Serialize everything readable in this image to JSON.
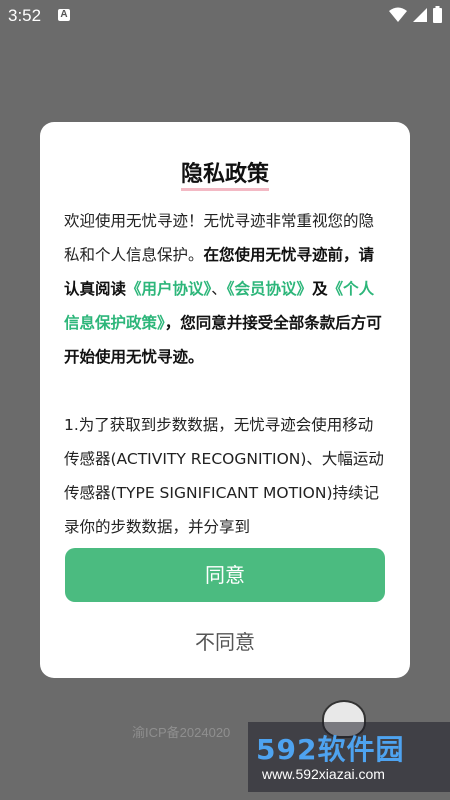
{
  "status_bar": {
    "time": "3:52",
    "notification_icon": "A",
    "icons": [
      "wifi-icon",
      "signal-icon",
      "battery-icon"
    ]
  },
  "background": {
    "footer_text": "渝ICP备2024020",
    "watermark_brand": "592软件园",
    "watermark_url": "www.592xiazai.com"
  },
  "dialog": {
    "title": "隐私政策",
    "p1_intro": "欢迎使用无忧寻迹！无忧寻迹非常重视您的隐私和个人信息保护。",
    "p1_bold_a": "在您使用无忧寻迹前，请认真阅读",
    "link_user": "《用户协议》",
    "sep1": "、",
    "link_member": "《会员协议》",
    "sep2": "及",
    "link_privacy": "《个人信息保护政策》",
    "p1_bold_b": "，您同意并接受全部条款后方可开始使用无忧寻迹。",
    "p2": "1.为了获取到步数数据，无忧寻迹会使用移动传感器(ACTIVITY RECOGNITION)、大幅运动传感器(TYPE SIGNIFICANT MOTION)持续记录你的步数数据，并分享到",
    "agree_label": "同意",
    "disagree_label": "不同意"
  },
  "colors": {
    "accent": "#4bbb80",
    "link": "#2db67a",
    "overlay": "#6b6b6b"
  }
}
